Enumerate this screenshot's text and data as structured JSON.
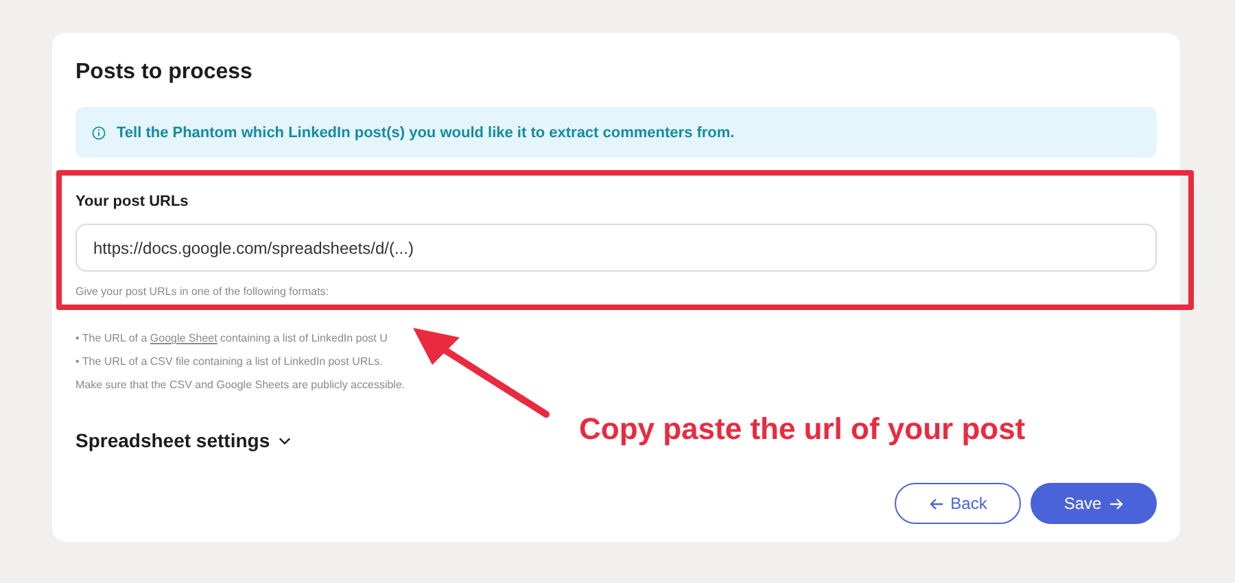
{
  "panel": {
    "title": "Posts to process",
    "info": "Tell the Phantom which LinkedIn post(s) you would like it to extract commenters from.",
    "field": {
      "label": "Your post URLs",
      "value": "https://docs.google.com/spreadsheets/d/(...)"
    },
    "help": "Give your post URLs in one of the following formats:",
    "bullets": [
      {
        "before": "• The URL of a ",
        "link": "Google Sheet",
        "after": " containing a list of LinkedIn post U"
      },
      {
        "before": "• The URL of a CSV file containing a list of LinkedIn post URLs."
      }
    ],
    "note": "Make sure that the CSV and Google Sheets are publicly accessible.",
    "section": {
      "label": "Spreadsheet settings",
      "expanded": false
    },
    "buttons": [
      {
        "label": "Back",
        "kind": "back"
      },
      {
        "label": "Save",
        "kind": "save"
      }
    ]
  },
  "annotation": {
    "text": "Copy paste the url of your post"
  }
}
